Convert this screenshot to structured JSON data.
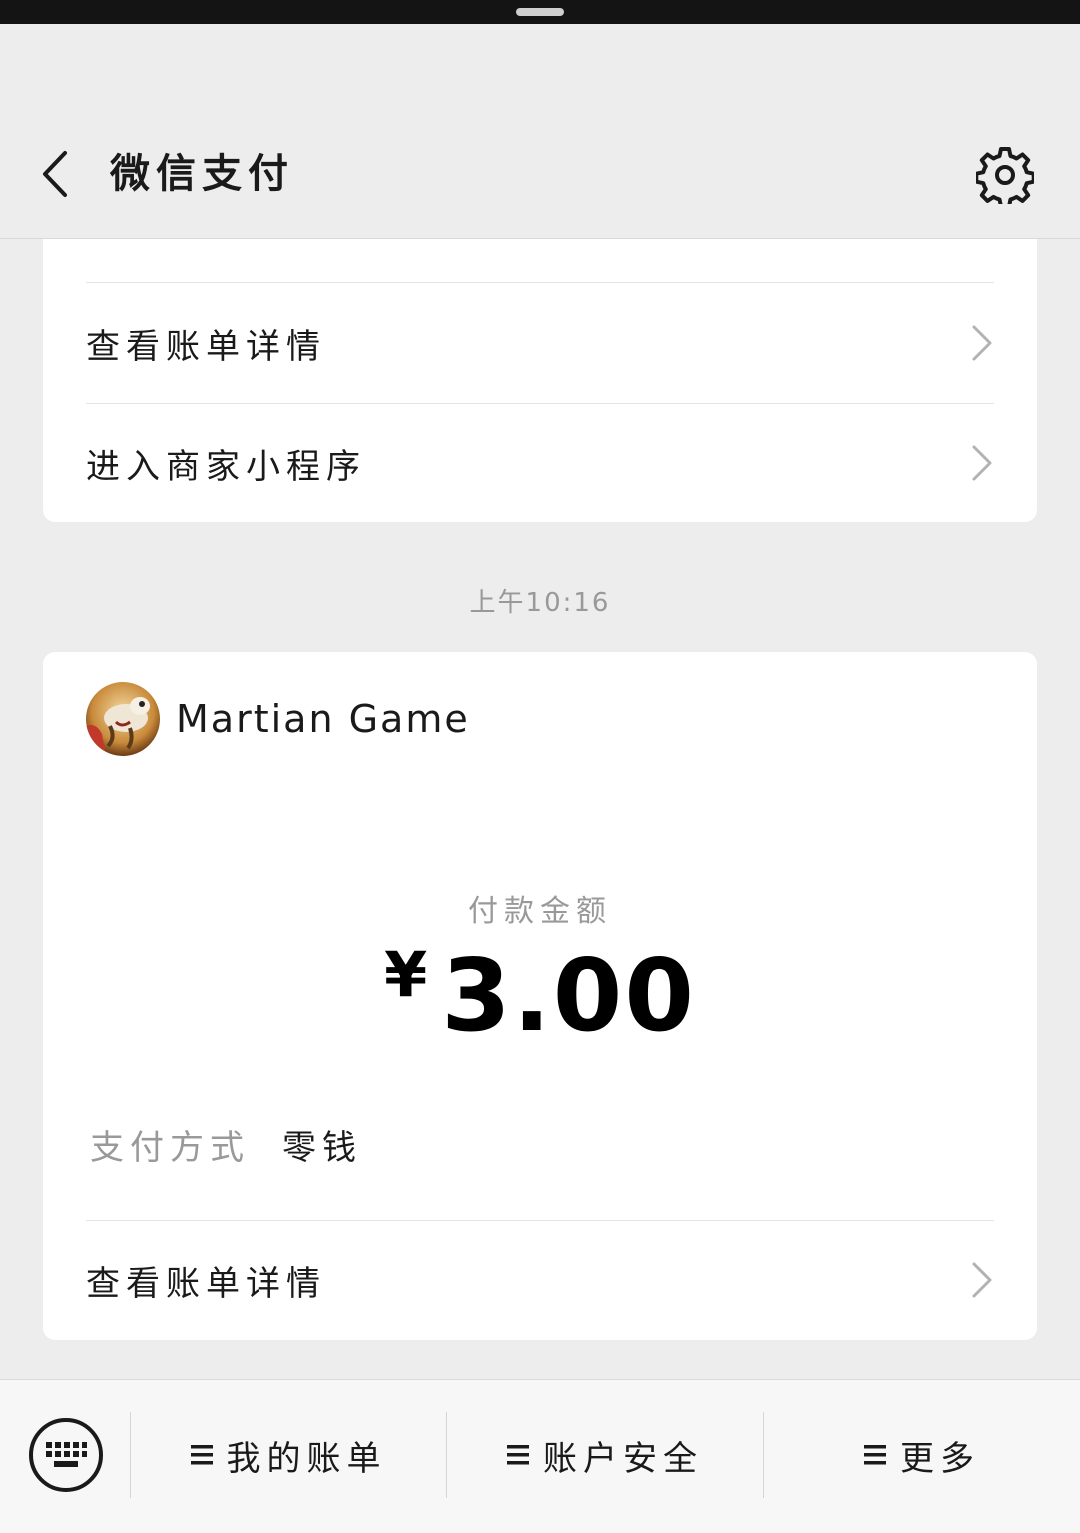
{
  "nav": {
    "title": "微信支付",
    "back_icon": "back-arrow-icon",
    "settings_icon": "gear-icon"
  },
  "top_card": {
    "rows": [
      {
        "label": "查看账单详情"
      },
      {
        "label": "进入商家小程序"
      }
    ]
  },
  "timestamp": "上午10:16",
  "payment_card": {
    "merchant_name": "Martian Game",
    "amount_label": "付款金额",
    "currency_symbol": "¥",
    "amount_value": "3.00",
    "method_key": "支付方式",
    "method_value": "零钱",
    "detail_row_label": "查看账单详情"
  },
  "bottom_menu": {
    "keyboard_icon": "keyboard-icon",
    "items": [
      {
        "label": "我的账单"
      },
      {
        "label": "账户安全"
      },
      {
        "label": "更多"
      }
    ]
  },
  "colors": {
    "page_bg": "#ededed",
    "card_bg": "#ffffff",
    "secondary_text": "#999999",
    "primary_text": "#1a1a1a"
  }
}
